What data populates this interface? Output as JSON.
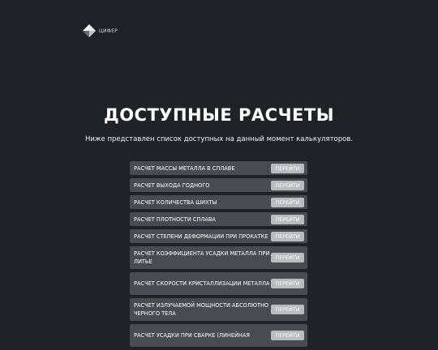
{
  "brand": {
    "logo_text": "ЦИФЕР",
    "logo_icon": "diamond-logo-icon"
  },
  "heading": {
    "title": "ДОСТУПНЫЕ РАСЧЕТЫ",
    "subtitle": "Ниже представлен список доступных на данный момент калькуляторов."
  },
  "calculators": [
    {
      "label": "РАСЧЕТ МАССЫ МЕТАЛЛА В СПЛАВЕ",
      "button": "ПЕРЕЙТИ"
    },
    {
      "label": "РАСЧЕТ ВЫХОДА ГОДНОГО",
      "button": "ПЕРЕЙТИ"
    },
    {
      "label": "РАСЧЕТ КОЛИЧЕСТВА ШИХТЫ",
      "button": "ПЕРЕЙТИ"
    },
    {
      "label": "РАСЧЕТ ПЛОТНОСТИ СПЛАВА",
      "button": "ПЕРЕЙТИ"
    },
    {
      "label": "РАСЧЕТ СТЕПЕНИ ДЕФОРМАЦИИ ПРИ ПРОКАТКЕ",
      "button": "ПЕРЕЙТИ"
    },
    {
      "label": "РАСЧЕТ КОЭФФИЦИЕНТА УСАДКИ МЕТАЛЛА ПРИ ЛИТЬЕ",
      "button": "ПЕРЕЙТИ"
    },
    {
      "label": "РАСЧЕТ СКОРОСТИ КРИСТАЛЛИЗАЦИИ МЕТАЛЛА",
      "button": "ПЕРЕЙТИ"
    },
    {
      "label": "РАСЧЕТ ИЗЛУЧАЕМОЙ МОЩНОСТИ АБСОЛЮТНО ЧЕРНОГО ТЕЛА",
      "button": "ПЕРЕЙТИ"
    },
    {
      "label": "РАСЧЕТ УСАДКИ ПРИ СВАРКЕ (ЛИНЕЙНАЯ",
      "button": "ПЕРЕЙТИ"
    }
  ]
}
